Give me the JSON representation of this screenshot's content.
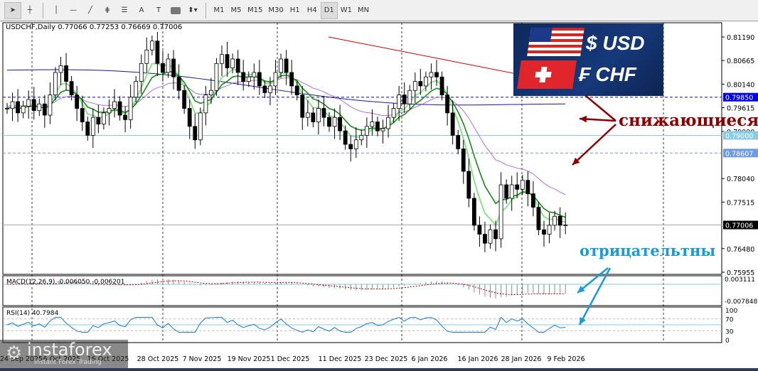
{
  "toolbar": {
    "tools": [
      "cursor-icon",
      "crosshair-icon",
      "vertical-line-icon",
      "horizontal-line-icon",
      "trendline-icon",
      "fibonacci-icon",
      "fibo-levels-icon",
      "text-icon",
      "text-label-icon",
      "rectangle-icon",
      "arrows-icon"
    ],
    "text_label": "A",
    "label_tool": "T",
    "timeframes": [
      "M1",
      "M5",
      "M15",
      "M30",
      "H1",
      "H4",
      "D1",
      "W1",
      "MN"
    ],
    "active_timeframe": "D1"
  },
  "chart": {
    "header": "USDCHF,Daily  0.77066 0.77253 0.76669 0.77006",
    "price_labels": [
      "0.81190",
      "0.80665",
      "0.80140",
      "0.79615",
      "0.79090",
      "0.78040",
      "0.77515",
      "0.76480",
      "0.75955"
    ],
    "hlines": [
      {
        "label": "0.79850",
        "value": 0.7985,
        "bg": "#0000ee",
        "style": "dash"
      },
      {
        "label": "0.79000",
        "value": 0.79,
        "bg": "#87cbe6",
        "style": "solid"
      },
      {
        "label": "0.78607",
        "value": 0.78607,
        "bg": "#6f9be0",
        "style": "dash"
      },
      {
        "label": "0.77006",
        "value": 0.77006,
        "bg": "#000000",
        "style": "solid"
      }
    ],
    "dates": [
      "24 Sep 2025",
      "6 Oct 2025",
      "16 Oct 2025",
      "28 Oct 2025",
      "7 Nov 2025",
      "19 Nov 2025",
      "1 Dec 2025",
      "11 Dec 2025",
      "23 Dec 2025",
      "6 Jan 2026",
      "16 Jan 2026",
      "28 Jan 2026",
      "9 Feb 2026"
    ],
    "macd": {
      "label": "MACD(12,26,9) -0.006050 -0.006201",
      "top": "0.003111",
      "zero": "0.000000",
      "bottom": "-0.007848"
    },
    "rsi": {
      "label": "RSI(14) 40.7984",
      "levels": [
        "100",
        "70",
        "50.0000",
        "30",
        "0"
      ]
    }
  },
  "chart_data": {
    "type": "candlestick",
    "symbol": "USDCHF",
    "timeframe": "Daily",
    "ylim": [
      0.7583,
      0.8145
    ],
    "closes": [
      0.796,
      0.7975,
      0.795,
      0.7965,
      0.798,
      0.7955,
      0.797,
      0.7945,
      0.799,
      0.804,
      0.8055,
      0.802,
      0.799,
      0.796,
      0.793,
      0.79,
      0.794,
      0.7925,
      0.795,
      0.796,
      0.7975,
      0.7945,
      0.7935,
      0.7985,
      0.802,
      0.806,
      0.809,
      0.811,
      0.806,
      0.804,
      0.807,
      0.803,
      0.8,
      0.796,
      0.792,
      0.789,
      0.795,
      0.799,
      0.8,
      0.806,
      0.808,
      0.805,
      0.807,
      0.804,
      0.802,
      0.803,
      0.804,
      0.801,
      0.7995,
      0.801,
      0.804,
      0.807,
      0.804,
      0.801,
      0.799,
      0.794,
      0.795,
      0.793,
      0.796,
      0.794,
      0.792,
      0.794,
      0.791,
      0.788,
      0.787,
      0.789,
      0.79,
      0.792,
      0.793,
      0.791,
      0.7915,
      0.794,
      0.796,
      0.799,
      0.797,
      0.8,
      0.802,
      0.801,
      0.803,
      0.804,
      0.803,
      0.799,
      0.795,
      0.79,
      0.787,
      0.782,
      0.776,
      0.77,
      0.768,
      0.766,
      0.769,
      0.767,
      0.779,
      0.776,
      0.779,
      0.778,
      0.78,
      0.777,
      0.774,
      0.769,
      0.768,
      0.77,
      0.772,
      0.77,
      0.77006
    ],
    "ma_long": {
      "color": "#cc0000",
      "from": 0.8119,
      "to": 0.8015
    },
    "ma_colors": {
      "fast": "#8fe08f",
      "mid": "#1a8a1a",
      "slow_violet": "#a050c0",
      "blue": "#1a1a8a"
    }
  },
  "flag": {
    "usd": "$ USD",
    "chf": "₣ CHF"
  },
  "annotations": {
    "falling": "снижающиеся",
    "negative": "отрицательтны",
    "falling_color": "#8b0000",
    "negative_color": "#1a9ad6"
  },
  "logo": {
    "name": "instaforex",
    "tagline": "Instant Forex Trading"
  }
}
